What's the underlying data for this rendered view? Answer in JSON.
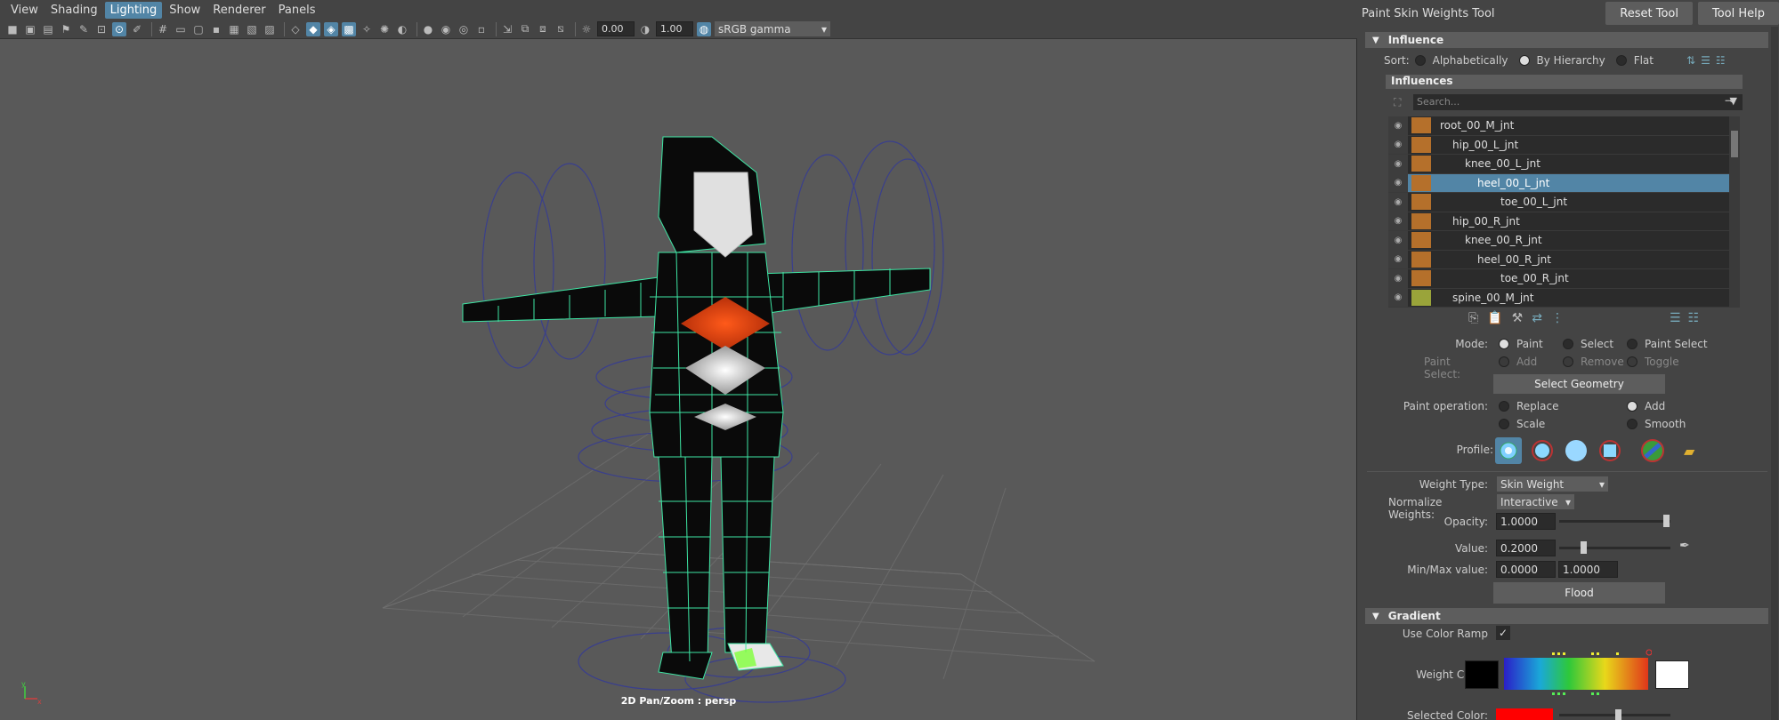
{
  "menubar": {
    "items": [
      "View",
      "Shading",
      "Lighting",
      "Show",
      "Renderer",
      "Panels"
    ],
    "active": "Lighting"
  },
  "toolbar": {
    "exposure": "0.00",
    "gamma": "1.00",
    "color_space": "sRGB gamma"
  },
  "viewport": {
    "hud_label": "2D Pan/Zoom : persp",
    "axis_x": "x",
    "axis_y": "y"
  },
  "panel": {
    "title": "Paint Skin Weights Tool",
    "reset_label": "Reset Tool",
    "help_label": "Tool Help",
    "influence_section": "Influence",
    "sort_label": "Sort:",
    "sort_options": [
      "Alphabetically",
      "By Hierarchy",
      "Flat"
    ],
    "influences_title": "Influences",
    "search_placeholder": "Search...",
    "joints": [
      {
        "name": "root_00_M_jnt",
        "color": "#b5702b"
      },
      {
        "name": "hip_00_L_jnt",
        "color": "#b5702b"
      },
      {
        "name": "knee_00_L_jnt",
        "color": "#b5702b"
      },
      {
        "name": "heel_00_L_jnt",
        "color": "#b5702b",
        "selected": true
      },
      {
        "name": "toe_00_L_jnt",
        "color": "#b5702b"
      },
      {
        "name": "hip_00_R_jnt",
        "color": "#b5702b"
      },
      {
        "name": "knee_00_R_jnt",
        "color": "#b5702b"
      },
      {
        "name": "heel_00_R_jnt",
        "color": "#b5702b"
      },
      {
        "name": "toe_00_R_jnt",
        "color": "#b5702b"
      },
      {
        "name": "spine_00_M_jnt",
        "color": "#9aa43a"
      }
    ],
    "mode_label": "Mode:",
    "mode_options": [
      "Paint",
      "Select",
      "Paint Select"
    ],
    "paint_select_label": "Paint Select:",
    "paint_select_options": [
      "Add",
      "Remove",
      "Toggle"
    ],
    "select_geometry": "Select Geometry",
    "paint_op_label": "Paint operation:",
    "paint_ops": [
      "Replace",
      "Add",
      "Scale",
      "Smooth"
    ],
    "profile_label": "Profile:",
    "weight_type_label": "Weight Type:",
    "weight_type_value": "Skin Weight",
    "normalize_label": "Normalize Weights:",
    "normalize_value": "Interactive",
    "opacity_label": "Opacity:",
    "opacity_value": "1.0000",
    "value_label": "Value:",
    "value_value": "0.2000",
    "minmax_label": "Min/Max value:",
    "min_value": "0.0000",
    "max_value": "1.0000",
    "flood": "Flood",
    "gradient_section": "Gradient",
    "use_color_ramp": "Use Color Ramp",
    "weight_color": "Weight Color:",
    "selected_color": "Selected Color:"
  }
}
